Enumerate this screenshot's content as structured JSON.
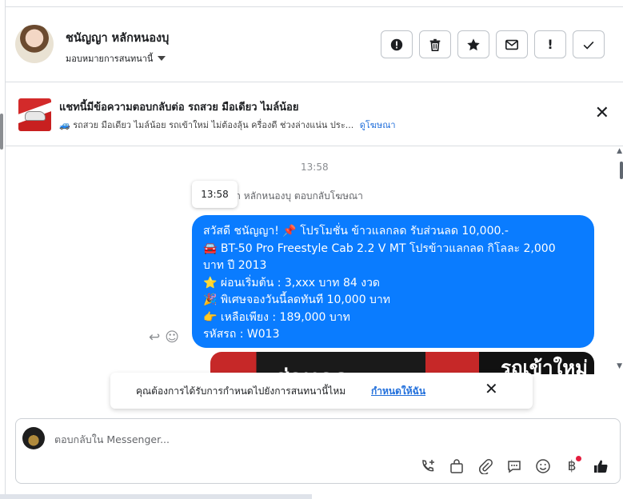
{
  "header": {
    "contact_name": "ชนัญญา หลักหนองบุ",
    "assign_label": "มอบหมายการสนทนานี้",
    "actions": [
      {
        "name": "report-button",
        "icon": "exclamation-circle-icon"
      },
      {
        "name": "delete-button",
        "icon": "trash-icon"
      },
      {
        "name": "star-button",
        "icon": "star-icon"
      },
      {
        "name": "mark-unread-button",
        "icon": "envelope-icon"
      },
      {
        "name": "follow-up-button",
        "icon": "exclamation-icon",
        "glyph": "!"
      },
      {
        "name": "done-button",
        "icon": "check-icon"
      }
    ]
  },
  "ad": {
    "title": "แชทนี้มีข้อความตอบกลับต่อ รถสวย มือเดียว ไมล์น้อย",
    "subtitle": "🚙 รถสวย มือเดียว ไมล์น้อย รถเข้าใหม่ ไม่ต้องลุ้น ครื่องดี ช่วงล่างแน่น ประ...",
    "link": "ดูโฆษณา",
    "close": "✕"
  },
  "conversation": {
    "timestamp": "13:58",
    "tooltip_time": "13:58",
    "replied_note": "ญา หลักหนองบุ ตอบกลับโฆษณา",
    "message_lines": [
      "สวัสดี ชนัญญา! 📌 โปรโมชั่น ข้าวแลกลด รับส่วนลด 10,000.-",
      "🚘 BT-50 Pro Freestyle Cab 2.2 V MT โปรข้าวแลกลด กิโลละ 2,000",
      "บาท ปี 2013",
      "⭐ ผ่อนเริ่มต้น : 3,xxx บาท 84 งวด",
      "🎉 พิเศษจองวันนี้ลดทันที 10,000 บาท",
      "👉 เหลือเพียง : 189,000 บาท",
      "รหัสรถ : W013"
    ],
    "image_texts": [
      "ส่วนลด",
      "รถเข้าใหม่"
    ]
  },
  "assign_banner": {
    "question": "คุณต้องการได้รับการกำหนดไปยังการสนทนานี้ไหม",
    "action": "กำหนดให้ฉัน",
    "close": "✕"
  },
  "composer": {
    "placeholder": "ตอบกลับใน Messenger..."
  },
  "colors": {
    "bubble": "#0a7cff",
    "link": "#216fdb",
    "notification_dot": "#e41e3f"
  }
}
